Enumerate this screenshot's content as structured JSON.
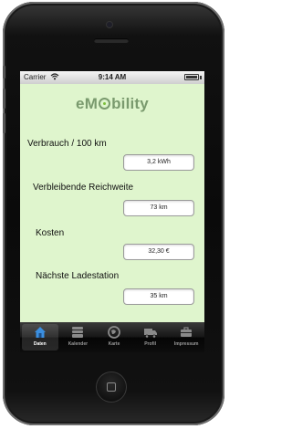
{
  "status_bar": {
    "carrier": "Carrier",
    "time": "9:14 AM"
  },
  "app": {
    "logo_prefix": "eM",
    "logo_suffix": "bility"
  },
  "fields": [
    {
      "label": "Verbrauch / 100 km",
      "value": "3,2 kWh"
    },
    {
      "label": "Verbleibende Reichweite",
      "value": "73 km"
    },
    {
      "label": "Kosten",
      "value": "32,30 €"
    },
    {
      "label": "Nächste Ladestation",
      "value": "35 km"
    }
  ],
  "tabs": [
    {
      "label": "Daten",
      "icon": "house-icon",
      "active": true
    },
    {
      "label": "Kalender",
      "icon": "calendar-icon",
      "active": false
    },
    {
      "label": "Karte",
      "icon": "globe-icon",
      "active": false
    },
    {
      "label": "Profil",
      "icon": "truck-icon",
      "active": false
    },
    {
      "label": "Impressum",
      "icon": "briefcase-icon",
      "active": false
    }
  ],
  "colors": {
    "screen_background": "#dff5cd",
    "logo": "#7a9a6e",
    "tabbar": "#151515",
    "active_tab_icon": "#3b8fe0"
  }
}
